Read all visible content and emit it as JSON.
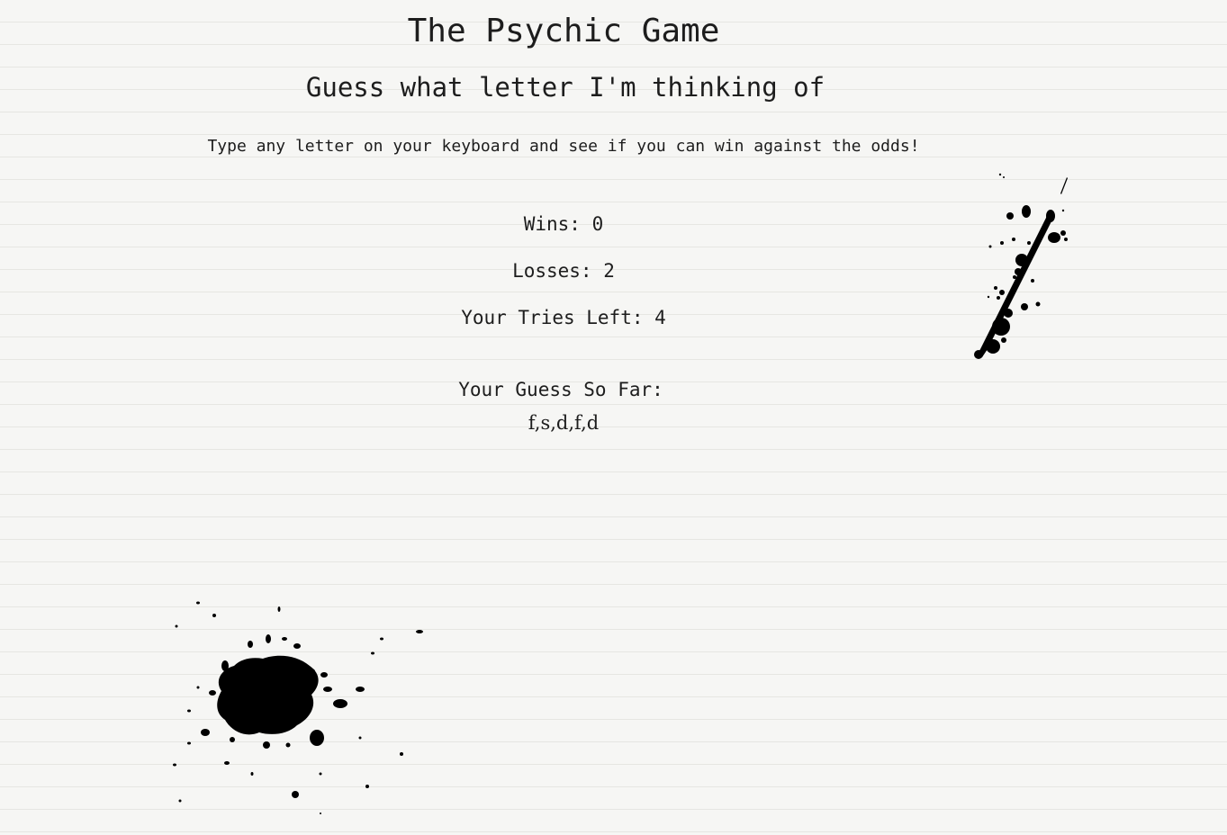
{
  "header": {
    "title": "The Psychic Game",
    "subtitle": "Guess what letter I'm thinking of"
  },
  "instructions": "Type any letter on your keyboard and see if you can win against the odds!",
  "stats": {
    "wins_label": "Wins:",
    "wins_value": "0",
    "losses_label": "Losses:",
    "losses_value": "2",
    "tries_label": "Your Tries Left:",
    "tries_value": "4"
  },
  "guesses": {
    "label": "Your Guess So Far:",
    "value": "f,s,d,f,d"
  },
  "decorations": {
    "ink_color": "#000000",
    "top_splatter": "ink-splatter-streak",
    "bottom_splatter": "ink-splatter-blot"
  }
}
